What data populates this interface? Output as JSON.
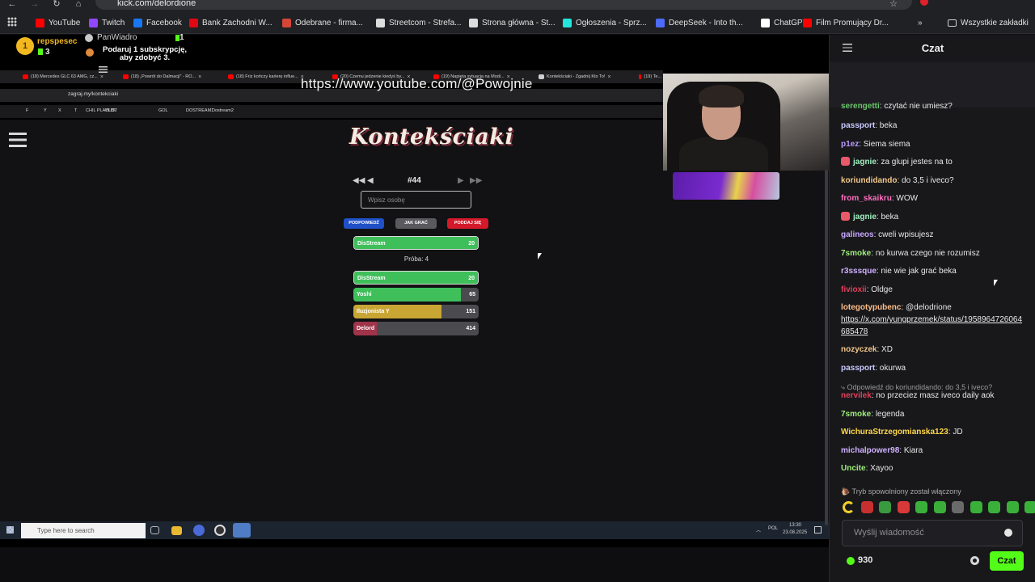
{
  "browser": {
    "url": "kick.com/delordione",
    "bookmarks": [
      {
        "label": "YouTube",
        "color": "#ff0000"
      },
      {
        "label": "Twitch",
        "color": "#9146ff"
      },
      {
        "label": "Facebook",
        "color": "#1877f2"
      },
      {
        "label": "Bank Zachodni W...",
        "color": "#e30613"
      },
      {
        "label": "Odebrane - firma...",
        "color": "#d44638"
      },
      {
        "label": "Streetcom - Strefa...",
        "color": "#dddddd"
      },
      {
        "label": "Strona główna - St...",
        "color": "#dddddd"
      },
      {
        "label": "Ogłoszenia - Sprz...",
        "color": "#23e5db"
      },
      {
        "label": "DeepSeek - Into th...",
        "color": "#4d6bfe"
      },
      {
        "label": "ChatGPT",
        "color": "#ffffff"
      },
      {
        "label": "Film Promujący Dr...",
        "color": "#ff0000"
      }
    ],
    "all_bookmarks": "Wszystkie zakładki"
  },
  "stream": {
    "overlay_url": "https://www.youtube.com/@Powojnie",
    "inner_tabs": [
      "(18) Mercedes GLC 63 AMG, cz...",
      "(18) „Powrót do Dalmacji” - RO...",
      "(18) Friz kończy karierę influe...",
      "(20) Czemu jedzenie kiedyś by...",
      "(19) Napięta sytuacja na Modi...",
      "Kontekściaki - Zgadnij Kto To!",
      "(19) Te..."
    ],
    "inner_url": "zagraj.my/kontekciaki",
    "inner_bookmarks": [
      "F",
      "Y",
      "X",
      "T",
      "CHIL PLAYLIST",
      "OLD\\",
      "GOL",
      "DOSTREAM1",
      "Dostream2"
    ],
    "game": {
      "logo": "Kontekściaki",
      "puzzle_number": "#44",
      "input_placeholder": "Wpisz osobę",
      "buttons": {
        "hint": "PODPOWIEDŹ",
        "how_to": "JAK GRAĆ",
        "give_up": "PODDAJ SIĘ"
      },
      "attempt_label": "Próba: 4",
      "latest_guess": {
        "name": "DisStream",
        "value": "20",
        "fill": 1.0,
        "color": "#3fbf5a"
      },
      "guesses": [
        {
          "name": "DisStream",
          "value": "20",
          "fill": 1.0,
          "color": "#3fbf5a"
        },
        {
          "name": "Yoshi",
          "value": "65",
          "fill": 0.86,
          "color": "#3fbf5a"
        },
        {
          "name": "Iluzjonista Y",
          "value": "151",
          "fill": 0.7,
          "color": "#c9a634"
        },
        {
          "name": "Delord",
          "value": "414",
          "fill": 0.19,
          "color": "#a0344a"
        }
      ]
    },
    "taskbar": {
      "search_placeholder": "Type here to search",
      "lang": "POL",
      "time": "13:30",
      "date": "23.08.2025"
    }
  },
  "chat": {
    "title": "Czat",
    "top_gifter": {
      "rank": "1",
      "name": "repspesec",
      "count": "3"
    },
    "gift_goal": {
      "name": "PanWiadro",
      "count": "1",
      "promo": "Podaruj 1 subskrypcję, aby zdobyć 3."
    },
    "messages": [
      {
        "user": "serengetti",
        "text": "czytać nie umiesz?",
        "color": "#6cc46c"
      },
      {
        "user": "passport",
        "text": "beka",
        "color": "#c9c9ff"
      },
      {
        "user": "p1ez",
        "text": "Siema siema",
        "color": "#b99cff"
      },
      {
        "user": "jagnie",
        "text": "za glupi jestes na to",
        "color": "#9ff0c0",
        "badge": true
      },
      {
        "user": "koriundidando",
        "text": "do 3,5 i iveco?",
        "color": "#f2c78a"
      },
      {
        "user": "from_skaikru",
        "text": "WOW",
        "color": "#ff6fbf"
      },
      {
        "user": "jagnie",
        "text": "beka",
        "color": "#9ff0c0",
        "badge": true
      },
      {
        "user": "galineos",
        "text": "cweli wpisujesz",
        "color": "#c8a8ff"
      },
      {
        "user": "7smoke",
        "text": "no kurwa czego nie rozumisz",
        "color": "#9ff07a"
      },
      {
        "user": "r3sssque",
        "text": "nie wie jak grać beka",
        "color": "#d0b0ff"
      },
      {
        "user": "fivioxii",
        "text": "Oldge",
        "color": "#e0405a"
      },
      {
        "user": "lotegotypubenc",
        "text": "@delodrione",
        "color": "#ffc08a",
        "link": "https://x.com/yungprzemek/status/1958964726064685478"
      },
      {
        "user": "nozyczek",
        "text": "XD",
        "color": "#f2c78a"
      },
      {
        "user": "passport",
        "text": "okurwa",
        "color": "#c9c9ff"
      },
      {
        "user": "nervilek",
        "text": "no przeciez masz iveco daily aok",
        "color": "#e0405a"
      },
      {
        "user": "7smoke",
        "text": "legenda",
        "color": "#9ff07a"
      },
      {
        "user": "WichuraStrzegomianska123",
        "text": "JD",
        "color": "#ffd84a"
      },
      {
        "user": "michalpower98",
        "text": "Kiara",
        "color": "#d0b0ff"
      },
      {
        "user": "Uncite",
        "text": "Xayoo",
        "color": "#9ff07a"
      }
    ],
    "reply_ref": "Odpowiedź do koriundidando: do 3,5 i iveco?",
    "slow_mode": "Tryb spowolniony został włączony",
    "input_placeholder": "Wyślij wiadomość",
    "points": "930",
    "send_label": "Czat"
  }
}
